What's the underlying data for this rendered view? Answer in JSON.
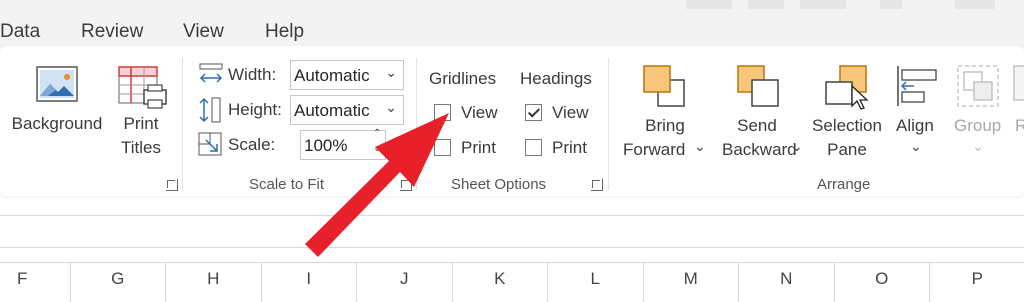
{
  "tabs": [
    "Data",
    "Review",
    "View",
    "Help"
  ],
  "page_setup": {
    "background_label": "Background",
    "print_titles_line1": "Print",
    "print_titles_line2": "Titles"
  },
  "scale_to_fit": {
    "width_label": "Width:",
    "width_value": "Automatic",
    "height_label": "Height:",
    "height_value": "Automatic",
    "scale_label": "Scale:",
    "scale_value": "100%",
    "group_label": "Scale to Fit"
  },
  "sheet_options": {
    "gridlines_header": "Gridlines",
    "headings_header": "Headings",
    "view_label": "View",
    "print_label": "Print",
    "gridlines_view_checked": false,
    "gridlines_print_checked": false,
    "headings_view_checked": true,
    "headings_print_checked": false,
    "group_label": "Sheet Options"
  },
  "arrange": {
    "bring_forward_line1": "Bring",
    "bring_forward_line2": "Forward",
    "send_backward_line1": "Send",
    "send_backward_line2": "Backward",
    "selection_pane_line1": "Selection",
    "selection_pane_line2": "Pane",
    "align_label": "Align",
    "group_label_btn": "Group",
    "rotate_partial": "R",
    "group_label": "Arrange"
  },
  "columns": [
    "F",
    "G",
    "H",
    "I",
    "J",
    "K",
    "L",
    "M",
    "N",
    "O",
    "P"
  ],
  "colors": {
    "annotation_arrow": "#e8202a",
    "accent_orange": "#f7c67a",
    "accent_blue": "#2f6db5"
  }
}
